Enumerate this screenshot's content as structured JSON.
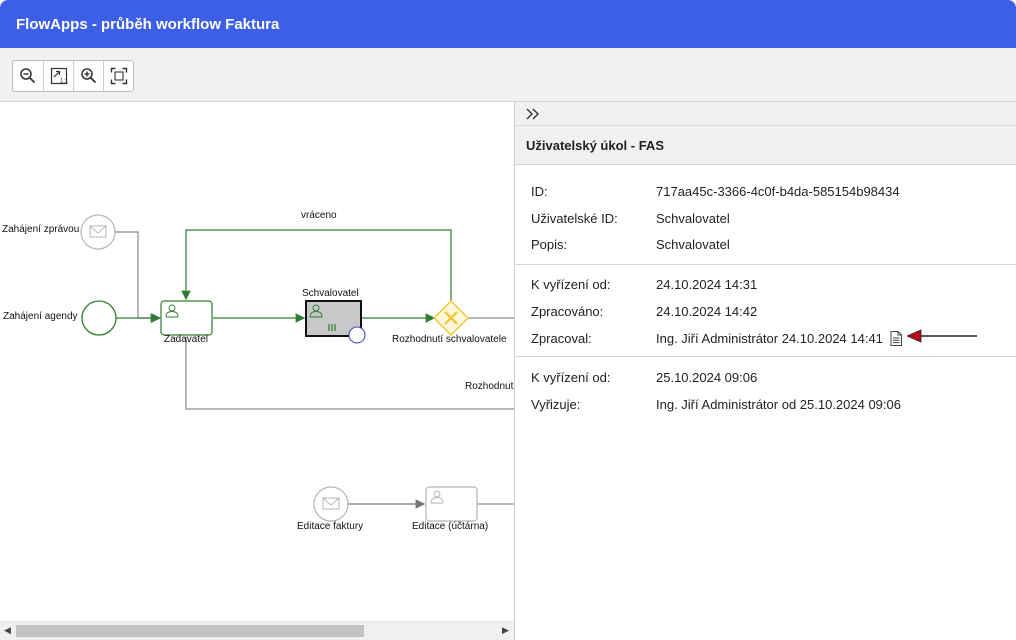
{
  "window": {
    "title": "FlowApps - průběh workflow Faktura"
  },
  "toolbar": {
    "buttons": [
      {
        "name": "zoom-out",
        "icon": "zoom-out-icon"
      },
      {
        "name": "fit",
        "icon": "zoom-fit-icon"
      },
      {
        "name": "zoom-in",
        "icon": "zoom-in-icon"
      },
      {
        "name": "full",
        "icon": "fit-page-icon"
      }
    ]
  },
  "diagram": {
    "labels": {
      "start_message": "Zahájení zprávou",
      "start_agenda": "Zahájení agendy",
      "returned": "vráceno",
      "zadavatel": "Zadavatel",
      "schvalovatel": "Schvalovatel",
      "gateway": "Rozhodnutí schvalovatele",
      "decision_cut": "Rozhodnut",
      "edit_invoice": "Editace faktury",
      "edit_accountant": "Editace (účtárna)"
    },
    "colors": {
      "active_flow": "#2e7d32",
      "inactive_flow": "#8c8c8c",
      "gateway": "#f2c230",
      "active_task": "#c8c8c8"
    }
  },
  "panel": {
    "collapse_icon": "double-chevron-right-icon",
    "title": "Uživatelský úkol - FAS",
    "section1": [
      {
        "label": "ID:",
        "value": "717aa45c-3366-4c0f-b4da-585154b98434"
      },
      {
        "label": "Uživatelské ID:",
        "value": "Schvalovatel"
      },
      {
        "label": "Popis:",
        "value": "Schvalovatel"
      }
    ],
    "section2": [
      {
        "label": "K vyřízení od:",
        "value": "24.10.2024 14:31"
      },
      {
        "label": "Zpracováno:",
        "value": "24.10.2024 14:42"
      },
      {
        "label": "Zpracoval:",
        "value": "Ing. Jiří Administrátor 24.10.2024 14:41"
      }
    ],
    "section3": [
      {
        "label": "K vyřízení od:",
        "value": "25.10.2024 09:06"
      },
      {
        "label": "Vyřizuje:",
        "value": "Ing. Jiří Administrátor od 25.10.2024 09:06"
      }
    ],
    "accent_arrow_color": "#c0001a"
  }
}
